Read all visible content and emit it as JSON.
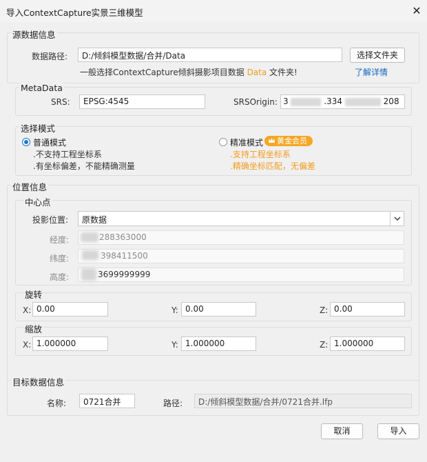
{
  "window": {
    "title": "导入ContextCapture实景三维模型",
    "close_glyph": "✕"
  },
  "source": {
    "group_title": "源数据信息",
    "path_label": "数据路径:",
    "path_value": "D:/倾斜模型数据/合并/Data",
    "choose_folder": "选择文件夹",
    "hint_prefix": "一般选择ContextCapture倾斜摄影项目数据",
    "hint_accent": "Data",
    "hint_suffix": "文件夹!",
    "learn_more": "了解详情"
  },
  "metadata": {
    "group_title": "MetaData",
    "srs_label": "SRS:",
    "srs_value": "EPSG:4545",
    "srsorigin_label": "SRSOrigin:",
    "srsorigin_part1": "3",
    "srsorigin_part2": ".334",
    "srsorigin_part3": "208"
  },
  "mode": {
    "group_title": "选择模式",
    "normal": {
      "label": "普通模式",
      "line1": ".不支持工程坐标系",
      "line2": ".有坐标偏差，不能精确测量",
      "checked": true
    },
    "precise": {
      "label": "精准模式",
      "badge": "黄金会员",
      "line1": ".支持工程坐标系",
      "line2": ".精确坐标匹配，无偏差",
      "checked": false
    },
    "colors": {
      "accent": "#f29b1f",
      "badge": "#f5a623",
      "radio": "#1976d2"
    }
  },
  "position": {
    "group_title": "位置信息",
    "center": {
      "group_title": "中心点",
      "projection_label": "投影位置:",
      "projection_value": "原数据",
      "lon_label": "经度:",
      "lon_value": "288363000",
      "lat_label": "纬度:",
      "lat_value": "398411500",
      "alt_label": "高度:",
      "alt_value": "3699999999"
    },
    "rotation": {
      "group_title": "旋转",
      "x_label": "X:",
      "x_value": "0.00",
      "y_label": "Y:",
      "y_value": "0.00",
      "z_label": "Z:",
      "z_value": "0.00"
    },
    "scale": {
      "group_title": "缩放",
      "x_label": "X:",
      "x_value": "1.000000",
      "y_label": "Y:",
      "y_value": "1.000000",
      "z_label": "Z:",
      "z_value": "1.000000"
    }
  },
  "target": {
    "group_title": "目标数据信息",
    "name_label": "名称:",
    "name_value": "0721合并",
    "path_label": "路径:",
    "path_value": "D:/倾斜模型数据/合并/0721合并.lfp"
  },
  "footer": {
    "cancel": "取消",
    "import": "导入"
  }
}
